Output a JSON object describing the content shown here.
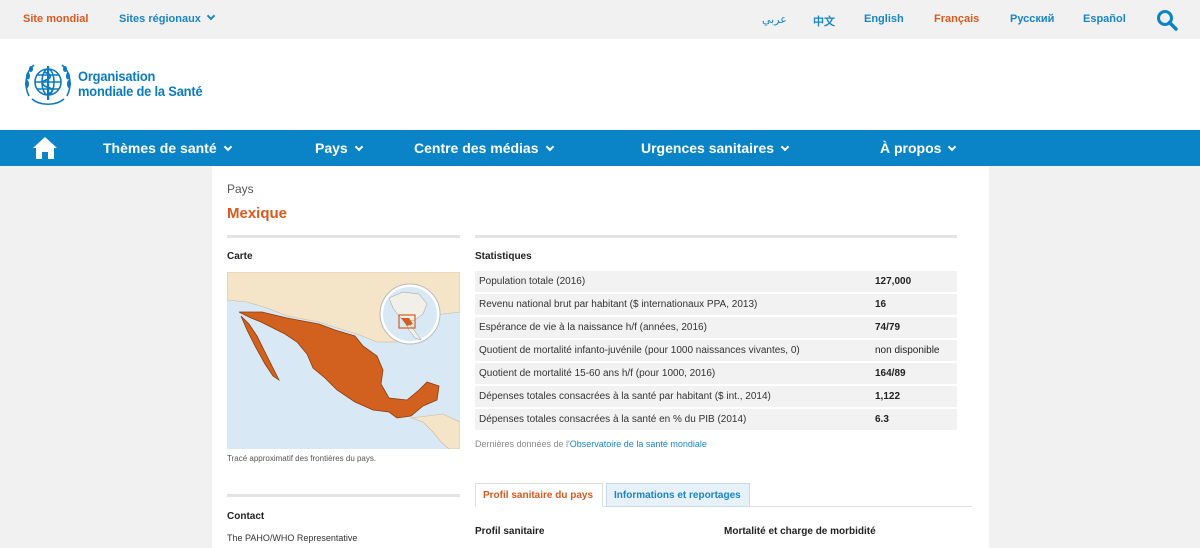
{
  "topbar": {
    "global_site": "Site mondial",
    "regional_sites": "Sites régionaux",
    "languages": [
      "عربي",
      "中文",
      "English",
      "Français",
      "Русский",
      "Español"
    ]
  },
  "logo": {
    "line1": "Organisation",
    "line2": "mondiale de la Santé"
  },
  "nav": {
    "items": [
      "Thèmes de santé",
      "Pays",
      "Centre des médias",
      "Urgences sanitaires",
      "À propos"
    ]
  },
  "page": {
    "breadcrumb": "Pays",
    "title": "Mexique"
  },
  "map": {
    "heading": "Carte",
    "caption": "Tracé approximatif des frontières du pays."
  },
  "stats": {
    "heading": "Statistiques",
    "rows": [
      {
        "label": "Population totale (2016)",
        "value": "127,000"
      },
      {
        "label": "Revenu national brut par habitant ($ internationaux PPA, 2013)",
        "value": "16"
      },
      {
        "label": "Espérance de vie à la naissance h/f (années, 2016)",
        "value": "74/79"
      },
      {
        "label": "Quotient de mortalité infanto-juvénile (pour 1000 naissances vivantes, 0)",
        "value": "non disponible"
      },
      {
        "label": "Quotient de mortalité 15-60 ans h/f (pour 1000, 2016)",
        "value": "164/89"
      },
      {
        "label": "Dépenses totales consacrées à la santé par habitant ($ int., 2014)",
        "value": "1,122"
      },
      {
        "label": "Dépenses totales consacrées à la santé en % du PIB (2014)",
        "value": "6.3"
      }
    ],
    "source_prefix": "Dernières données de l'",
    "source_link": "Observatoire de la santé mondiale"
  },
  "tabs": {
    "active": "Profil sanitaire du pays",
    "inactive": "Informations et reportages"
  },
  "contact": {
    "heading": "Contact",
    "text": "The PAHO/WHO Representative"
  },
  "sections": {
    "profil": "Profil sanitaire",
    "mortalite": "Mortalité et charge de morbidité"
  },
  "colors": {
    "accent_orange": "#d85a1e",
    "nav_blue": "#0a84c7",
    "link_blue": "#1a85c7"
  }
}
